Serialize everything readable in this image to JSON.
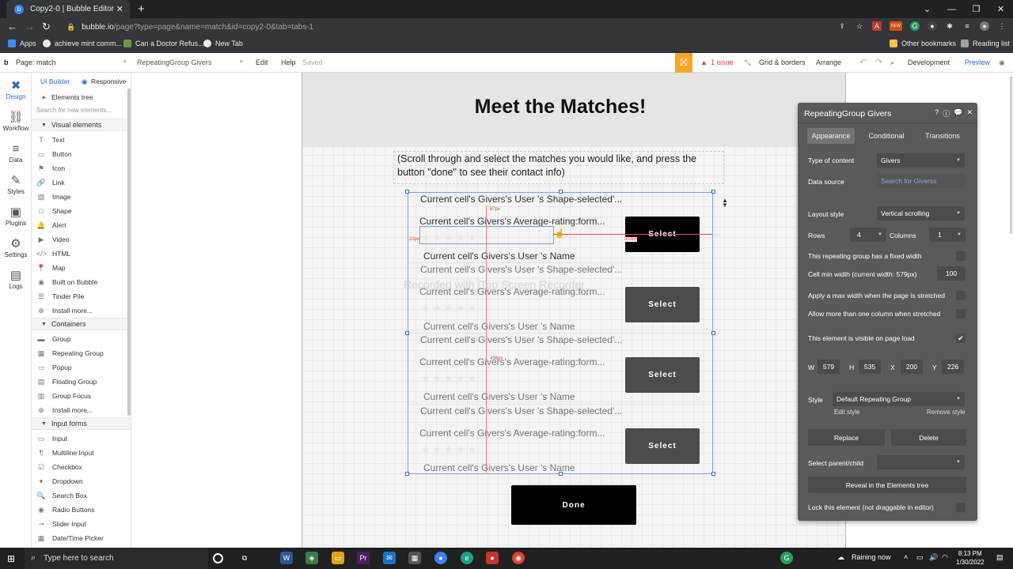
{
  "browser": {
    "tab_title": "Copy2-0 | Bubble Editor",
    "tab_close": "✕",
    "new_tab": "+",
    "win_controls": [
      "⌄",
      "—",
      "❐",
      "✕"
    ],
    "url_host": "bubble.io",
    "url_path": "/page?type=page&name=match&id=copy2-0&tab=tabs-1",
    "bookmarks": [
      {
        "label": "Apps",
        "color": "#4a8af4"
      },
      {
        "label": "achieve mint comm...",
        "color": "#e8eaed"
      },
      {
        "label": "Can a Doctor Refus...",
        "color": "#6a9a3a"
      },
      {
        "label": "New Tab",
        "color": "#e8eaed"
      }
    ],
    "other_bookmarks": "Other bookmarks",
    "reading_list": "Reading list",
    "ext_new_badge": "NEW"
  },
  "editor_top": {
    "page_label": "Page: match",
    "element_label": "RepeatingGroup Givers",
    "edit": "Edit",
    "help": "Help",
    "saved": "Saved",
    "issues": "1 issue",
    "grid_borders": "Grid & borders",
    "arrange": "Arrange",
    "development": "Development",
    "preview": "Preview"
  },
  "rail": [
    {
      "label": "Design",
      "glyph": "✖"
    },
    {
      "label": "Workflow",
      "glyph": "⛓"
    },
    {
      "label": "Data",
      "glyph": "≡"
    },
    {
      "label": "Styles",
      "glyph": "✎"
    },
    {
      "label": "Plugins",
      "glyph": "▣"
    },
    {
      "label": "Settings",
      "glyph": "⚙"
    },
    {
      "label": "Logs",
      "glyph": "▤"
    }
  ],
  "left_panel": {
    "ui_builder": "UI Builder",
    "responsive": "Responsive",
    "elements_tree": "Elements tree",
    "search_placeholder": "Search for new elements...",
    "visual_elements_title": "Visual elements",
    "visual_elements": [
      {
        "label": "Text",
        "icon": "T"
      },
      {
        "label": "Button",
        "icon": "▭"
      },
      {
        "label": "Icon",
        "icon": "⚑"
      },
      {
        "label": "Link",
        "icon": "🔗"
      },
      {
        "label": "Image",
        "icon": "▨"
      },
      {
        "label": "Shape",
        "icon": "□"
      },
      {
        "label": "Alert",
        "icon": "🔔"
      },
      {
        "label": "Video",
        "icon": "▶"
      },
      {
        "label": "HTML",
        "icon": "</>"
      },
      {
        "label": "Map",
        "icon": "📍"
      },
      {
        "label": "Built on Bubble",
        "icon": "◉"
      },
      {
        "label": "Tinder Pile",
        "icon": "☰"
      },
      {
        "label": "Install more...",
        "icon": "⊕"
      }
    ],
    "containers_title": "Containers",
    "containers": [
      {
        "label": "Group",
        "icon": "▬"
      },
      {
        "label": "Repeating Group",
        "icon": "▦"
      },
      {
        "label": "Popup",
        "icon": "▭"
      },
      {
        "label": "Floating Group",
        "icon": "▤"
      },
      {
        "label": "Group Focus",
        "icon": "▥"
      },
      {
        "label": "Install more...",
        "icon": "⊕"
      }
    ],
    "input_forms_title": "Input forms",
    "input_forms": [
      {
        "label": "Input",
        "icon": "▭"
      },
      {
        "label": "Multiline Input",
        "icon": "¶"
      },
      {
        "label": "Checkbox",
        "icon": "☑"
      },
      {
        "label": "Dropdown",
        "icon": "▾"
      },
      {
        "label": "Search Box",
        "icon": "🔍"
      },
      {
        "label": "Radio Buttons",
        "icon": "◉"
      },
      {
        "label": "Slider Input",
        "icon": "⊸"
      },
      {
        "label": "Date/Time Picker",
        "icon": "▦"
      }
    ]
  },
  "canvas": {
    "title": "Meet the Matches!",
    "instructions": "(Scroll through and select the matches you would like, and press the button \"done\" to see their contact info)",
    "cell_shape": "Current cell's Givers's User 's Shape-selected'...",
    "cell_rating": "Current cell's Givers's Average-rating:form...",
    "cell_name": "Current cell's Givers's User 's Name",
    "select_label": "Select",
    "done_label": "Done",
    "stars": "★★★★★",
    "watermark": "Recorded with iTop Screen Recorder",
    "dim_a": "67px",
    "dim_b": "22px",
    "dim_c": "303px",
    "dim_d": "436px"
  },
  "property_editor": {
    "title": "RepeatingGroup Givers",
    "tabs": [
      "Appearance",
      "Conditional",
      "Transitions"
    ],
    "type_of_content_label": "Type of content",
    "type_of_content": "Givers",
    "data_source_label": "Data source",
    "data_source": "Search for Giverss",
    "layout_style_label": "Layout style",
    "layout_style": "Vertical scrolling",
    "rows_label": "Rows",
    "rows": "4",
    "columns_label": "Columns",
    "columns": "1",
    "fixed_width_label": "This repeating group has a fixed width",
    "cell_min_width_label": "Cell min width (current width: 579px)",
    "cell_min_width": "100",
    "max_width_label": "Apply a max width when the page is stretched",
    "more_columns_label": "Allow more than one column when stretched",
    "visible_label": "This element is visible on page load",
    "visible_check": "✔",
    "w_label": "W",
    "w": "579",
    "h_label": "H",
    "h": "535",
    "x_label": "X",
    "x": "200",
    "y_label": "Y",
    "y": "226",
    "style_label": "Style",
    "style": "Default Repeating Group",
    "edit_style": "Edit style",
    "remove_style": "Remove style",
    "replace": "Replace",
    "delete": "Delete",
    "select_parent_label": "Select parent/child",
    "reveal": "Reveal in the Elements tree",
    "lock_label": "Lock this element (not draggable in editor)"
  },
  "taskbar": {
    "search_placeholder": "Type here to search",
    "weather": "Raining now",
    "time": "8:13 PM",
    "date": "1/30/2022"
  }
}
